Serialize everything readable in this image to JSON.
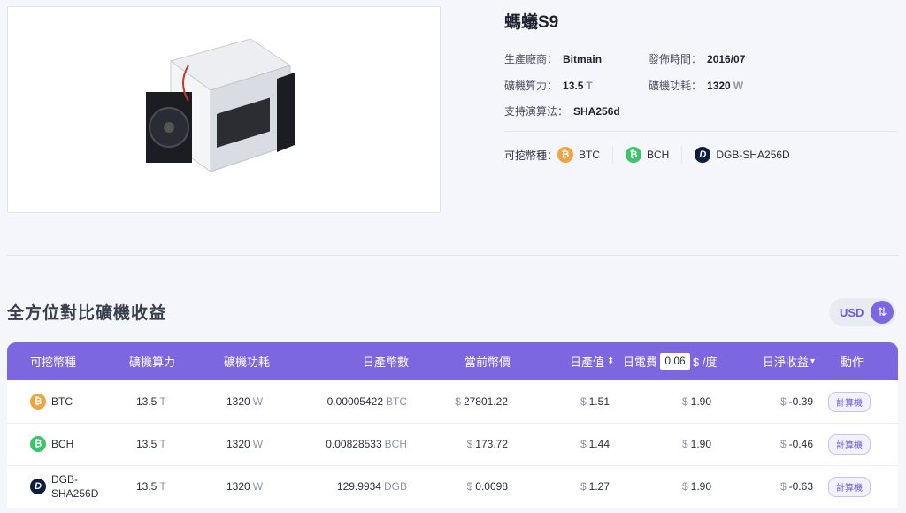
{
  "product": {
    "title": "螞蟻S9",
    "specs": {
      "manufacturer_label": "生產廠商：",
      "manufacturer": "Bitmain",
      "release_label": "發佈時間：",
      "release": "2016/07",
      "hashrate_label": "礦機算力：",
      "hashrate": "13.5",
      "hashrate_unit": "T",
      "power_label": "礦機功耗：",
      "power": "1320",
      "power_unit": "W",
      "algo_label": "支持演算法：",
      "algo": "SHA256d"
    },
    "coins_label": "可挖幣種：",
    "coins": [
      {
        "name": "BTC",
        "icon": "bitcoin-icon",
        "symbol": "₿"
      },
      {
        "name": "BCH",
        "icon": "bitcoin-cash-icon",
        "symbol": "₿"
      },
      {
        "name": "DGB-SHA256D",
        "icon": "digibyte-icon",
        "symbol": "D"
      }
    ]
  },
  "section_title": "全方位對比礦機收益",
  "currency": {
    "label": "USD",
    "swap_symbol": "⇅"
  },
  "colors": {
    "accent": "#7c67e0",
    "btc": "#f0a341",
    "bch": "#3cc36b",
    "dgb": "#0e1d3d"
  },
  "table": {
    "headers": {
      "coin": "可挖幣種",
      "hashrate": "礦機算力",
      "power": "礦機功耗",
      "daily_coins": "日產幣數",
      "price": "當前幣價",
      "daily_value": "日產值",
      "sort_both": "⬍",
      "elec_prefix": "日電費",
      "elec_value": "0.06",
      "elec_suffix": "$ /度",
      "daily_net": "日淨收益",
      "sort_desc": "▾",
      "action": "動作"
    },
    "rows": [
      {
        "coin": "BTC",
        "symbol": "₿",
        "hashrate": "13.5",
        "hashrate_unit": "T",
        "power": "1320",
        "power_unit": "W",
        "daily_coins": "0.00005422",
        "daily_coins_unit": "BTC",
        "price": "27801.22",
        "daily_value": "1.51",
        "elec": "1.90",
        "net": "-0.39",
        "action": "計算機"
      },
      {
        "coin": "BCH",
        "symbol": "₿",
        "hashrate": "13.5",
        "hashrate_unit": "T",
        "power": "1320",
        "power_unit": "W",
        "daily_coins": "0.00828533",
        "daily_coins_unit": "BCH",
        "price": "173.72",
        "daily_value": "1.44",
        "elec": "1.90",
        "net": "-0.46",
        "action": "計算機"
      },
      {
        "coin": "DGB-SHA256D",
        "symbol": "D",
        "hashrate": "13.5",
        "hashrate_unit": "T",
        "power": "1320",
        "power_unit": "W",
        "daily_coins": "129.9934",
        "daily_coins_unit": "DGB",
        "price": "0.0098",
        "daily_value": "1.27",
        "elec": "1.90",
        "net": "-0.63",
        "action": "計算機"
      }
    ],
    "currency_symbol": "$"
  }
}
